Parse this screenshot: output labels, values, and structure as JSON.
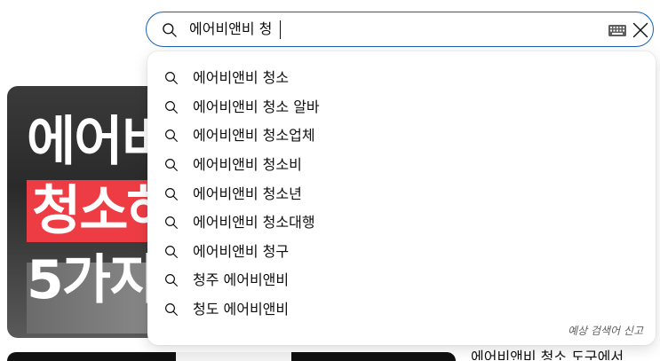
{
  "search": {
    "value": "에어비앤비 청",
    "clear_label": "Clear search"
  },
  "suggestions": [
    {
      "text": "에어비앤비 청소"
    },
    {
      "text": "에어비앤비 청소 알바"
    },
    {
      "text": "에어비앤비 청소업체"
    },
    {
      "text": "에어비앤비 청소비"
    },
    {
      "text": "에어비앤비 청소년"
    },
    {
      "text": "에어비앤비 청소대행"
    },
    {
      "text": "에어비앤비 청구"
    },
    {
      "text": "청주 에어비앤비"
    },
    {
      "text": "청도 에어비앤비"
    }
  ],
  "report_link": "예상 검색어 신고",
  "background": {
    "thumbnail_lines": [
      "에어비",
      "청소하",
      "5가지"
    ],
    "bottom_title": "에어비앤비 청소 도구에서"
  },
  "colors": {
    "focus_border": "#1c62b9",
    "thumb_highlight": "#ee3c44",
    "report_text": "#606060"
  },
  "icons": {
    "search": "magnifier-icon",
    "keyboard": "keyboard-icon",
    "clear": "x-icon"
  }
}
